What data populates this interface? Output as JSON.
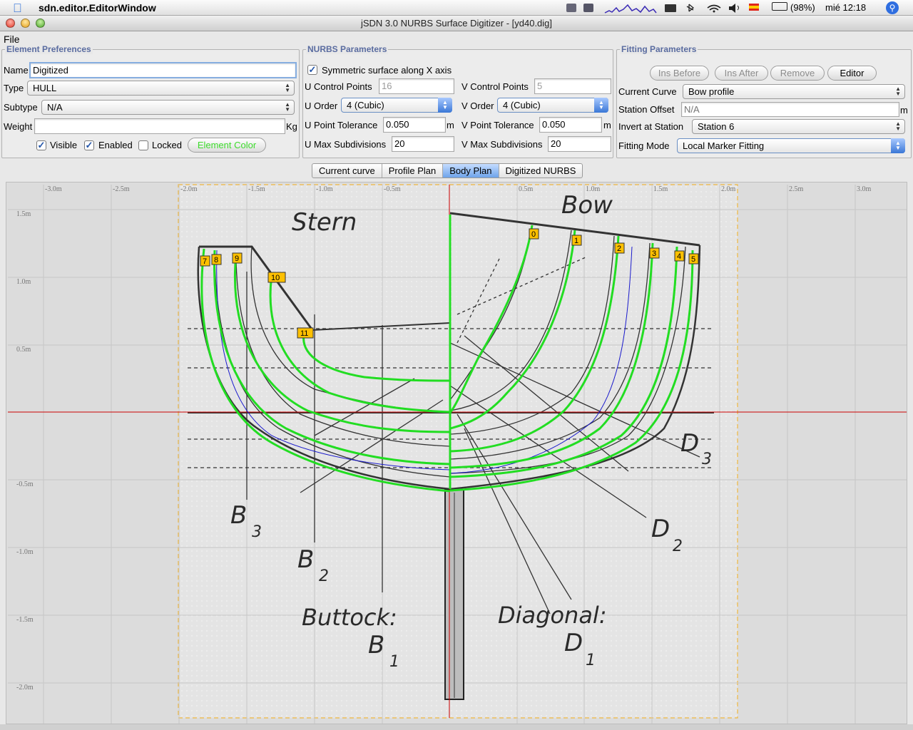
{
  "menubar": {
    "app_name": "sdn.editor.EditorWindow",
    "battery": "(98%)",
    "clock": "mié 12:18"
  },
  "window": {
    "title": "jSDN 3.0 NURBS Surface Digitizer - [yd40.dig]"
  },
  "menu": {
    "file": "File"
  },
  "element_preferences": {
    "legend": "Element Preferences",
    "name_label": "Name",
    "name_value": "Digitized",
    "type_label": "Type",
    "type_value": "HULL",
    "subtype_label": "Subtype",
    "subtype_value": "N/A",
    "weight_label": "Weight",
    "weight_value": "",
    "weight_unit": "Kg",
    "visible_label": "Visible",
    "visible_checked": true,
    "enabled_label": "Enabled",
    "enabled_checked": true,
    "locked_label": "Locked",
    "locked_checked": false,
    "color_button": "Element Color",
    "color_button_color": "#3ddc2c"
  },
  "nurbs_parameters": {
    "legend": "NURBS Parameters",
    "symmetric_label": "Symmetric surface along X axis",
    "symmetric_checked": true,
    "u_control_points_label": "U Control Points",
    "u_control_points_value": "16",
    "v_control_points_label": "V Control Points",
    "v_control_points_value": "5",
    "u_order_label": "U Order",
    "u_order_value": "4 (Cubic)",
    "v_order_label": "V Order",
    "v_order_value": "4 (Cubic)",
    "u_point_tolerance_label": "U Point Tolerance",
    "u_point_tolerance_value": "0.050",
    "v_point_tolerance_label": "V Point Tolerance",
    "v_point_tolerance_value": "0.050",
    "unit": "m",
    "u_max_subdivisions_label": "U Max Subdivisions",
    "u_max_subdivisions_value": "20",
    "v_max_subdivisions_label": "V Max Subdivisions",
    "v_max_subdivisions_value": "20"
  },
  "fitting_parameters": {
    "legend": "Fitting Parameters",
    "ins_before": "Ins Before",
    "ins_after": "Ins After",
    "remove": "Remove",
    "editor": "Editor",
    "current_curve_label": "Current Curve",
    "current_curve_value": "Bow profile",
    "station_offset_label": "Station Offset",
    "station_offset_placeholder": "N/A",
    "station_offset_unit": "m",
    "invert_label": "Invert at Station",
    "invert_value": "Station 6",
    "fitting_mode_label": "Fitting Mode",
    "fitting_mode_value": "Local Marker Fitting"
  },
  "tabs": [
    {
      "label": "Current curve",
      "selected": false
    },
    {
      "label": "Profile Plan",
      "selected": false
    },
    {
      "label": "Body Plan",
      "selected": true
    },
    {
      "label": "Digitized NURBS",
      "selected": false
    }
  ],
  "body_plan": {
    "x_ticks": [
      "-3.0m",
      "-2.5m",
      "-2.0m",
      "-1.5m",
      "-1.0m",
      "-0.5m",
      "0.5m",
      "1.0m",
      "1.5m",
      "2.0m",
      "2.5m",
      "3.0m"
    ],
    "y_ticks": [
      "1.5m",
      "1.0m",
      "0.5m",
      "-0.5m",
      "-1.0m",
      "-1.5m",
      "-2.0m"
    ],
    "drawing_labels": {
      "stern": "Stern",
      "bow": "Bow",
      "b3": "B",
      "b3_sub": "3",
      "b2": "B",
      "b2_sub": "2",
      "buttock": "Buttock:",
      "b1": "B",
      "b1_sub": "1",
      "d3": "D",
      "d3_sub": "3",
      "d2": "D",
      "d2_sub": "2",
      "diagonal": "Diagonal:",
      "d1": "D",
      "d1_sub": "1"
    },
    "station_markers": [
      "0",
      "1",
      "2",
      "3",
      "4",
      "5",
      "7",
      "8",
      "9",
      "10",
      "11"
    ],
    "curve_color": "#22dd22",
    "marker_color": "#ffc000",
    "axis_color": "#cc0000"
  }
}
